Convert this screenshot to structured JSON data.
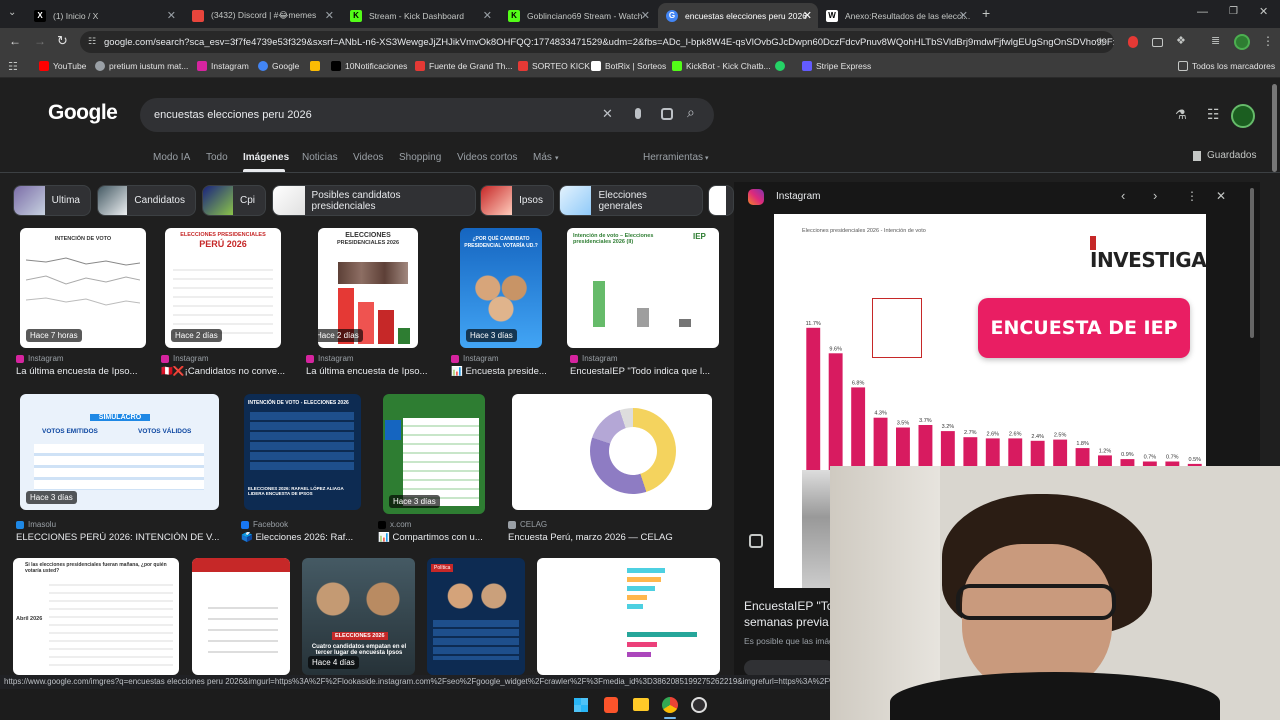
{
  "browser": {
    "tabs": [
      {
        "label": "(1) Inicio / X",
        "icon": "x-logo-icon",
        "color": "#000000"
      },
      {
        "label": "(3432) Discord | #😂memes",
        "icon": "discord-icon",
        "color": "#e8453c"
      },
      {
        "label": "Stream - Kick Dashboard",
        "icon": "kick-icon",
        "color": "#53fc18"
      },
      {
        "label": "Goblinciano69 Stream - Watch",
        "icon": "kick-icon",
        "color": "#53fc18"
      },
      {
        "label": "encuestas elecciones peru 2026",
        "icon": "google-icon",
        "color": "#4285f4"
      },
      {
        "label": "Anexo:Resultados de las elecci...",
        "icon": "wikipedia-icon",
        "color": "#ffffff"
      }
    ],
    "url": "google.com/search?sca_esv=3f7fe4739e53f329&sxsrf=ANbL-n6-XS3WewgeJjZHJikVmvOk8OHFQQ:1774833471529&udm=2&fbs=ADc_l-bpk8W4E-qsVlOvbGJcDwpn60DczFdcvPnuv8WQohHLTbSVldBrj9mdwFjfwlgEUgSngOnSDVho99Fxf...",
    "bookmarks": [
      {
        "label": "YouTube",
        "color": "#ff0000"
      },
      {
        "label": "pretium iustum mat...",
        "color": "#9aa0a6"
      },
      {
        "label": "Instagram",
        "color": "#d6249f"
      },
      {
        "label": "Google",
        "color": "#4285f4"
      },
      {
        "label": "",
        "color": "#fbbc04"
      },
      {
        "label": "10Notificaciones",
        "color": "#000000"
      },
      {
        "label": "Fuente de Grand Th...",
        "color": "#e53935"
      },
      {
        "label": "SORTEO KICK",
        "color": "#e53935"
      },
      {
        "label": "BotRix | Sorteos",
        "color": "#ffffff"
      },
      {
        "label": "KickBot - Kick Chatb...",
        "color": "#53fc18"
      },
      {
        "label": "",
        "color": "#25d366"
      },
      {
        "label": "Stripe Express",
        "color": "#635bff"
      }
    ],
    "all_bookmarks": "Todos los marcadores"
  },
  "google": {
    "logo": "Google",
    "query": "encuestas elecciones peru 2026",
    "nav_tabs": [
      "Modo IA",
      "Todo",
      "Imágenes",
      "Noticias",
      "Videos",
      "Shopping",
      "Videos cortos",
      "Más"
    ],
    "tools": "Herramientas",
    "saved": "Guardados",
    "chips": [
      "Ultima",
      "Candidatos",
      "Cpi",
      "Posibles candidatos presidenciales",
      "Ipsos",
      "Elecciones generales"
    ],
    "results": [
      {
        "source": "Instagram",
        "title": "La última encuesta de Ipso...",
        "badge": "Hace 7 horas",
        "src_color": "#d6249f"
      },
      {
        "source": "Instagram",
        "title": "🇵🇪❌¡Candidatos no conve...",
        "badge": "Hace 2 días",
        "src_color": "#d6249f"
      },
      {
        "source": "Instagram",
        "title": "La última encuesta de Ipso...",
        "badge": "Hace 2 días",
        "src_color": "#d6249f"
      },
      {
        "source": "Instagram",
        "title": "📊 Encuesta preside...",
        "badge": "Hace 3 días",
        "src_color": "#d6249f"
      },
      {
        "source": "Instagram",
        "title": "EncuestaIEP \"Todo indica que l...",
        "badge": "",
        "src_color": "#d6249f"
      },
      {
        "source": "Imasolu",
        "title": "ELECCIONES PERÚ 2026: INTENCIÓN DE V...",
        "badge": "Hace 3 días",
        "src_color": "#1e88e5"
      },
      {
        "source": "Facebook",
        "title": "🗳️ Elecciones 2026: Raf...",
        "badge": "",
        "src_color": "#1877f2"
      },
      {
        "source": "x.com",
        "title": "📊 Compartimos con u...",
        "badge": "Hace 3 días",
        "src_color": "#000000"
      },
      {
        "source": "CELAG",
        "title": "Encuesta Perú, marzo 2026 — CELAG",
        "badge": "",
        "src_color": "#9aa0a6"
      },
      {
        "source": "",
        "title": "",
        "badge": "",
        "src_color": "#9aa0a6"
      },
      {
        "source": "",
        "title": "",
        "badge": "",
        "src_color": "#9aa0a6"
      },
      {
        "source": "",
        "title": "",
        "badge": "Hace 4 días",
        "src_color": "#9aa0a6"
      },
      {
        "source": "",
        "title": "",
        "badge": "",
        "src_color": "#9aa0a6"
      },
      {
        "source": "",
        "title": "",
        "badge": "",
        "src_color": "#9aa0a6"
      }
    ],
    "thumb_text": {
      "r1": "INTENCIÓN DE VOTO",
      "r2a": "ELECCIONES PRESIDENCIALES",
      "r2b": "PERÚ 2026",
      "r3a": "ELECCIONES",
      "r3b": "PRESIDENCIALES 2026",
      "r4a": "¿POR QUÉ CANDIDATO",
      "r4b": "PRESIDENCIAL VOTARÍA UD.?",
      "r5": "Intención de voto – Elecciones presidenciales 2026 (II)",
      "r5logo": "IEP",
      "r6a": "SIMULACRO",
      "r6b": "VOTOS EMITIDOS",
      "r6c": "VOTOS VÁLIDOS",
      "r7a": "INTENCIÓN DE VOTO - ELECCIONES 2026",
      "r7b": "ELECCIONES 2026: RAFAEL LÓPEZ ALIAGA LIDERA ENCUESTA DE IPSOS",
      "r10": "Si las elecciones presidenciales fueran mañana, ¿por quién votaría usted?",
      "r10b": "Abril 2026",
      "r12a": "ELECCIONES 2026",
      "r12b": "Cuatro candidatos empatan en el tercer lugar de encuesta Ipsos",
      "r13a": "Política"
    }
  },
  "panel": {
    "source": "Instagram",
    "brand": "INVESTIGA",
    "banner": "ENCUESTA DE IEP",
    "chart_title": "Elecciones presidenciales 2026 - Intención de voto",
    "caption": "EncuestaIEP \"To",
    "subcaption": "semanas previa",
    "desc": "Es posible que las imág"
  },
  "chart_data": {
    "type": "bar",
    "title": "Elecciones presidenciales 2026 - Intención de voto",
    "values": [
      11.7,
      9.6,
      6.8,
      4.3,
      3.5,
      3.7,
      3.2,
      2.7,
      2.6,
      2.6,
      2.4,
      2.5,
      1.8,
      1.2,
      0.9,
      0.7,
      0.7,
      0.5
    ],
    "labels": [
      "11.7%",
      "9.6%",
      "6.8%",
      "4.3%",
      "3.5%",
      "3.7%",
      "3.2%",
      "2.7%",
      "2.6%",
      "2.6%",
      "2.4%",
      "2.5%",
      "1.8%",
      "1.2%",
      "0.9%",
      "0.7%",
      "0.7%",
      "0.5%"
    ],
    "color": "#d81b60",
    "ylim": [
      0,
      13
    ]
  },
  "status_url": "https://www.google.com/imgres?q=encuestas elecciones peru 2026&imgurl=https%3A%2F%2Flookaside.instagram.com%2Fseo%2Fgoogle_widget%2Fcrawler%2F%3Fmedia_id%3D3862085199275262219&imgrefurl=https%3A%2F%2F"
}
